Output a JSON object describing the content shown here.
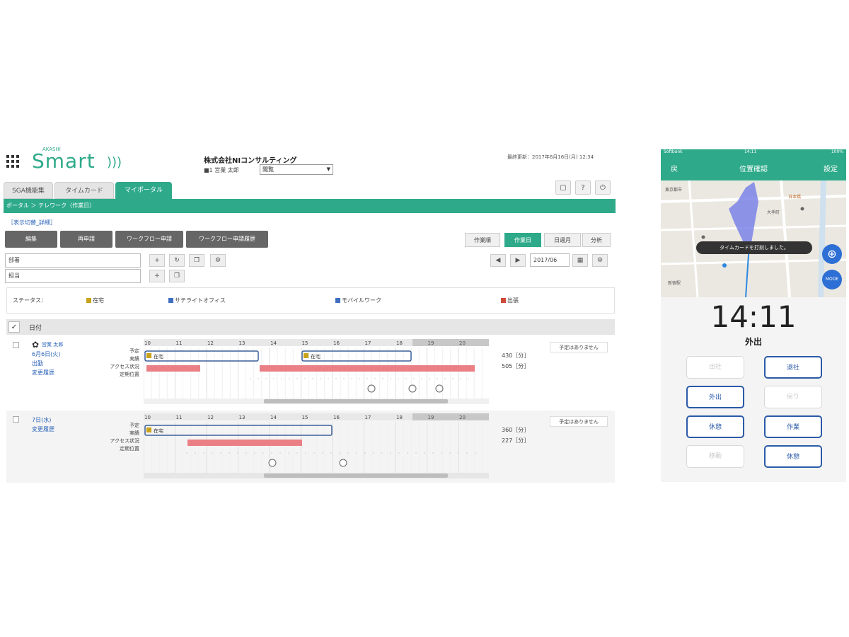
{
  "desktop": {
    "brand_small": "AKASHI",
    "brand": "Smart",
    "company": "株式会社NIコンサルティング",
    "user_prefix": "■1",
    "user_name": "営業 太郎",
    "select_value": "閲覧",
    "updated": "最終更新：2017年6月16日(月) 12:34",
    "tabs": [
      "SGA機能集",
      "タイムカード",
      "マイポータル"
    ],
    "active_tab": "マイポータル",
    "breadcrumb": "ポータル ＞ テレワーク（作業日）",
    "show_detail": "［表示切替_詳細］",
    "action_buttons": [
      "編集",
      "再申請",
      "ワークフロー申請",
      "ワークフロー申請履歴"
    ],
    "view_buttons": [
      "作業順",
      "作業日",
      "日週月",
      "分析"
    ],
    "active_view": "作業日",
    "filter1": "部署",
    "filter2": "担当",
    "date_value": "2017/06",
    "status_label": "ステータス：",
    "legend": [
      {
        "label": "在宅",
        "color": "#c8a219"
      },
      {
        "label": "サテライトオフィス",
        "color": "#3f6fc0"
      },
      {
        "label": "モバイルワーク",
        "color": "#3f6fc0"
      },
      {
        "label": "出張",
        "color": "#d04a3a"
      }
    ],
    "list_header": "日付",
    "row_labels": [
      "予定",
      "実績",
      "アクセス状況",
      "定期位置"
    ],
    "hours": [
      "10",
      "11",
      "12",
      "13",
      "14",
      "15",
      "16",
      "17",
      "18",
      "19",
      "20"
    ],
    "row1": {
      "user": "営業 太郎",
      "date": "6月6日(火)",
      "status": "出勤",
      "link": "変更履歴",
      "counts": [
        "430［分］",
        "505［分］"
      ],
      "plan_button": "予定はありません",
      "bar_labels": [
        "在宅",
        "在宅"
      ]
    },
    "row2": {
      "date": "7日(水)",
      "link": "変更履歴",
      "counts": [
        "360［分］",
        "227［分］"
      ],
      "plan_button": "予定はありません",
      "bar_label": "在宅"
    }
  },
  "mobile": {
    "status_carrier": "Softbank",
    "status_time": "14:11",
    "status_battery": "100%",
    "title": "位置確認",
    "left": "戻",
    "right": "設定",
    "toast": "タイムカードを打刻しました。",
    "map_labels": [
      "東京都市",
      "大手町",
      "日本橋",
      "新宿駅"
    ],
    "time": "14:11",
    "state": "外出",
    "mode_label": "MODE",
    "buttons": [
      {
        "label": "出社",
        "enabled": false
      },
      {
        "label": "退社",
        "enabled": true
      },
      {
        "label": "外出",
        "enabled": true
      },
      {
        "label": "戻り",
        "enabled": false
      },
      {
        "label": "休憩",
        "enabled": true
      },
      {
        "label": "作業",
        "enabled": true
      },
      {
        "label": "移動",
        "enabled": false
      },
      {
        "label": "休憩",
        "enabled": true
      }
    ]
  }
}
